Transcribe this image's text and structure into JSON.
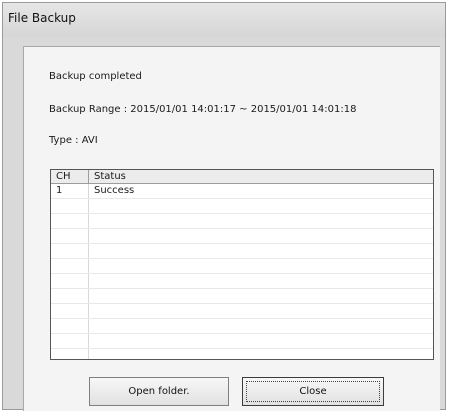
{
  "window": {
    "title": "File Backup"
  },
  "info": {
    "status_text": "Backup completed",
    "range_text": "Backup Range : 2015/01/01 14:01:17 ~ 2015/01/01 14:01:18",
    "type_text": "Type : AVI"
  },
  "table": {
    "columns": [
      "CH",
      "Status"
    ],
    "rows": [
      {
        "ch": "1",
        "status": "Success"
      },
      {
        "ch": "",
        "status": ""
      },
      {
        "ch": "",
        "status": ""
      },
      {
        "ch": "",
        "status": ""
      },
      {
        "ch": "",
        "status": ""
      },
      {
        "ch": "",
        "status": ""
      },
      {
        "ch": "",
        "status": ""
      },
      {
        "ch": "",
        "status": ""
      },
      {
        "ch": "",
        "status": ""
      },
      {
        "ch": "",
        "status": ""
      },
      {
        "ch": "",
        "status": ""
      },
      {
        "ch": "",
        "status": ""
      }
    ]
  },
  "buttons": {
    "open_folder_label": "Open folder.",
    "close_label": "Close"
  }
}
